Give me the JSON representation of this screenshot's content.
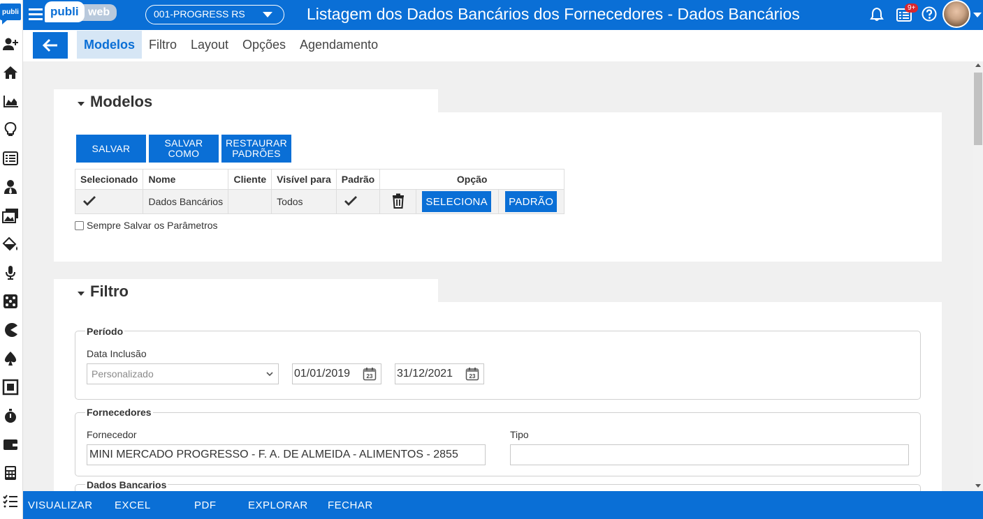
{
  "header": {
    "brand_publi": "publi",
    "brand_web": "web",
    "rail_logo": "publi",
    "company": "001-PROGRESS RS",
    "title": "Listagem dos Dados Bancários dos Fornecedores - Dados Bancários",
    "notification_badge": "9+"
  },
  "nav": {
    "tabs": [
      {
        "label": "Modelos"
      },
      {
        "label": "Filtro"
      },
      {
        "label": "Layout"
      },
      {
        "label": "Opções"
      },
      {
        "label": "Agendamento"
      }
    ],
    "active_tab": "Modelos"
  },
  "modelos": {
    "title": "Modelos",
    "buttons": {
      "salvar": "SALVAR",
      "salvar_como_1": "SALVAR",
      "salvar_como_2": "COMO",
      "restaurar_1": "RESTAURAR",
      "restaurar_2": "PADRÕES"
    },
    "columns": [
      "Selecionado",
      "Nome",
      "Cliente",
      "Visível para",
      "Padrão",
      "Opção"
    ],
    "rows": [
      {
        "selecionado": true,
        "nome": "Dados Bancários",
        "cliente": "",
        "visivel_para": "Todos",
        "padrao": true,
        "seleciona_label": "SELECIONA",
        "padrao_label": "PADRÃO"
      }
    ],
    "sempre_salvar_label": "Sempre Salvar os Parâmetros",
    "sempre_salvar_checked": false
  },
  "filtro": {
    "title": "Filtro",
    "periodo": {
      "legend": "Período",
      "data_inclusao_label": "Data Inclusão",
      "data_inclusao_select": "Personalizado",
      "date_from": "01/01/2019",
      "date_to": "31/12/2021",
      "calendar_day": "23"
    },
    "fornecedores": {
      "legend": "Fornecedores",
      "fornecedor_label": "Fornecedor",
      "fornecedor_value": "MINI MERCADO PROGRESSO - F. A. DE ALMEIDA - ALIMENTOS - 2855",
      "tipo_label": "Tipo",
      "tipo_value": ""
    },
    "dados_bancarios": {
      "legend": "Dados Bancarios"
    }
  },
  "footer": {
    "visualizar": "VISUALIZAR",
    "excel": "EXCEL",
    "pdf": "PDF",
    "explorar": "EXPLORAR",
    "fechar": "FECHAR"
  },
  "colors": {
    "primary": "#0a6fd6",
    "active_tab_bg": "#d6e6f5",
    "page_bg": "#f0f0f0"
  },
  "icons": {
    "rail": [
      "add-user-icon",
      "home-icon",
      "area-chart-icon",
      "lightbulb-icon",
      "list-icon",
      "user-tie-icon",
      "images-icon",
      "paint-bucket-icon",
      "microphone-icon",
      "dice-icon",
      "pacman-icon",
      "spade-icon",
      "stop-square-icon",
      "stopwatch-icon",
      "wallet-icon",
      "calculator-icon",
      "checklist-icon"
    ],
    "top": [
      "hamburger-icon",
      "bell-icon",
      "notes-icon",
      "help-icon"
    ]
  }
}
